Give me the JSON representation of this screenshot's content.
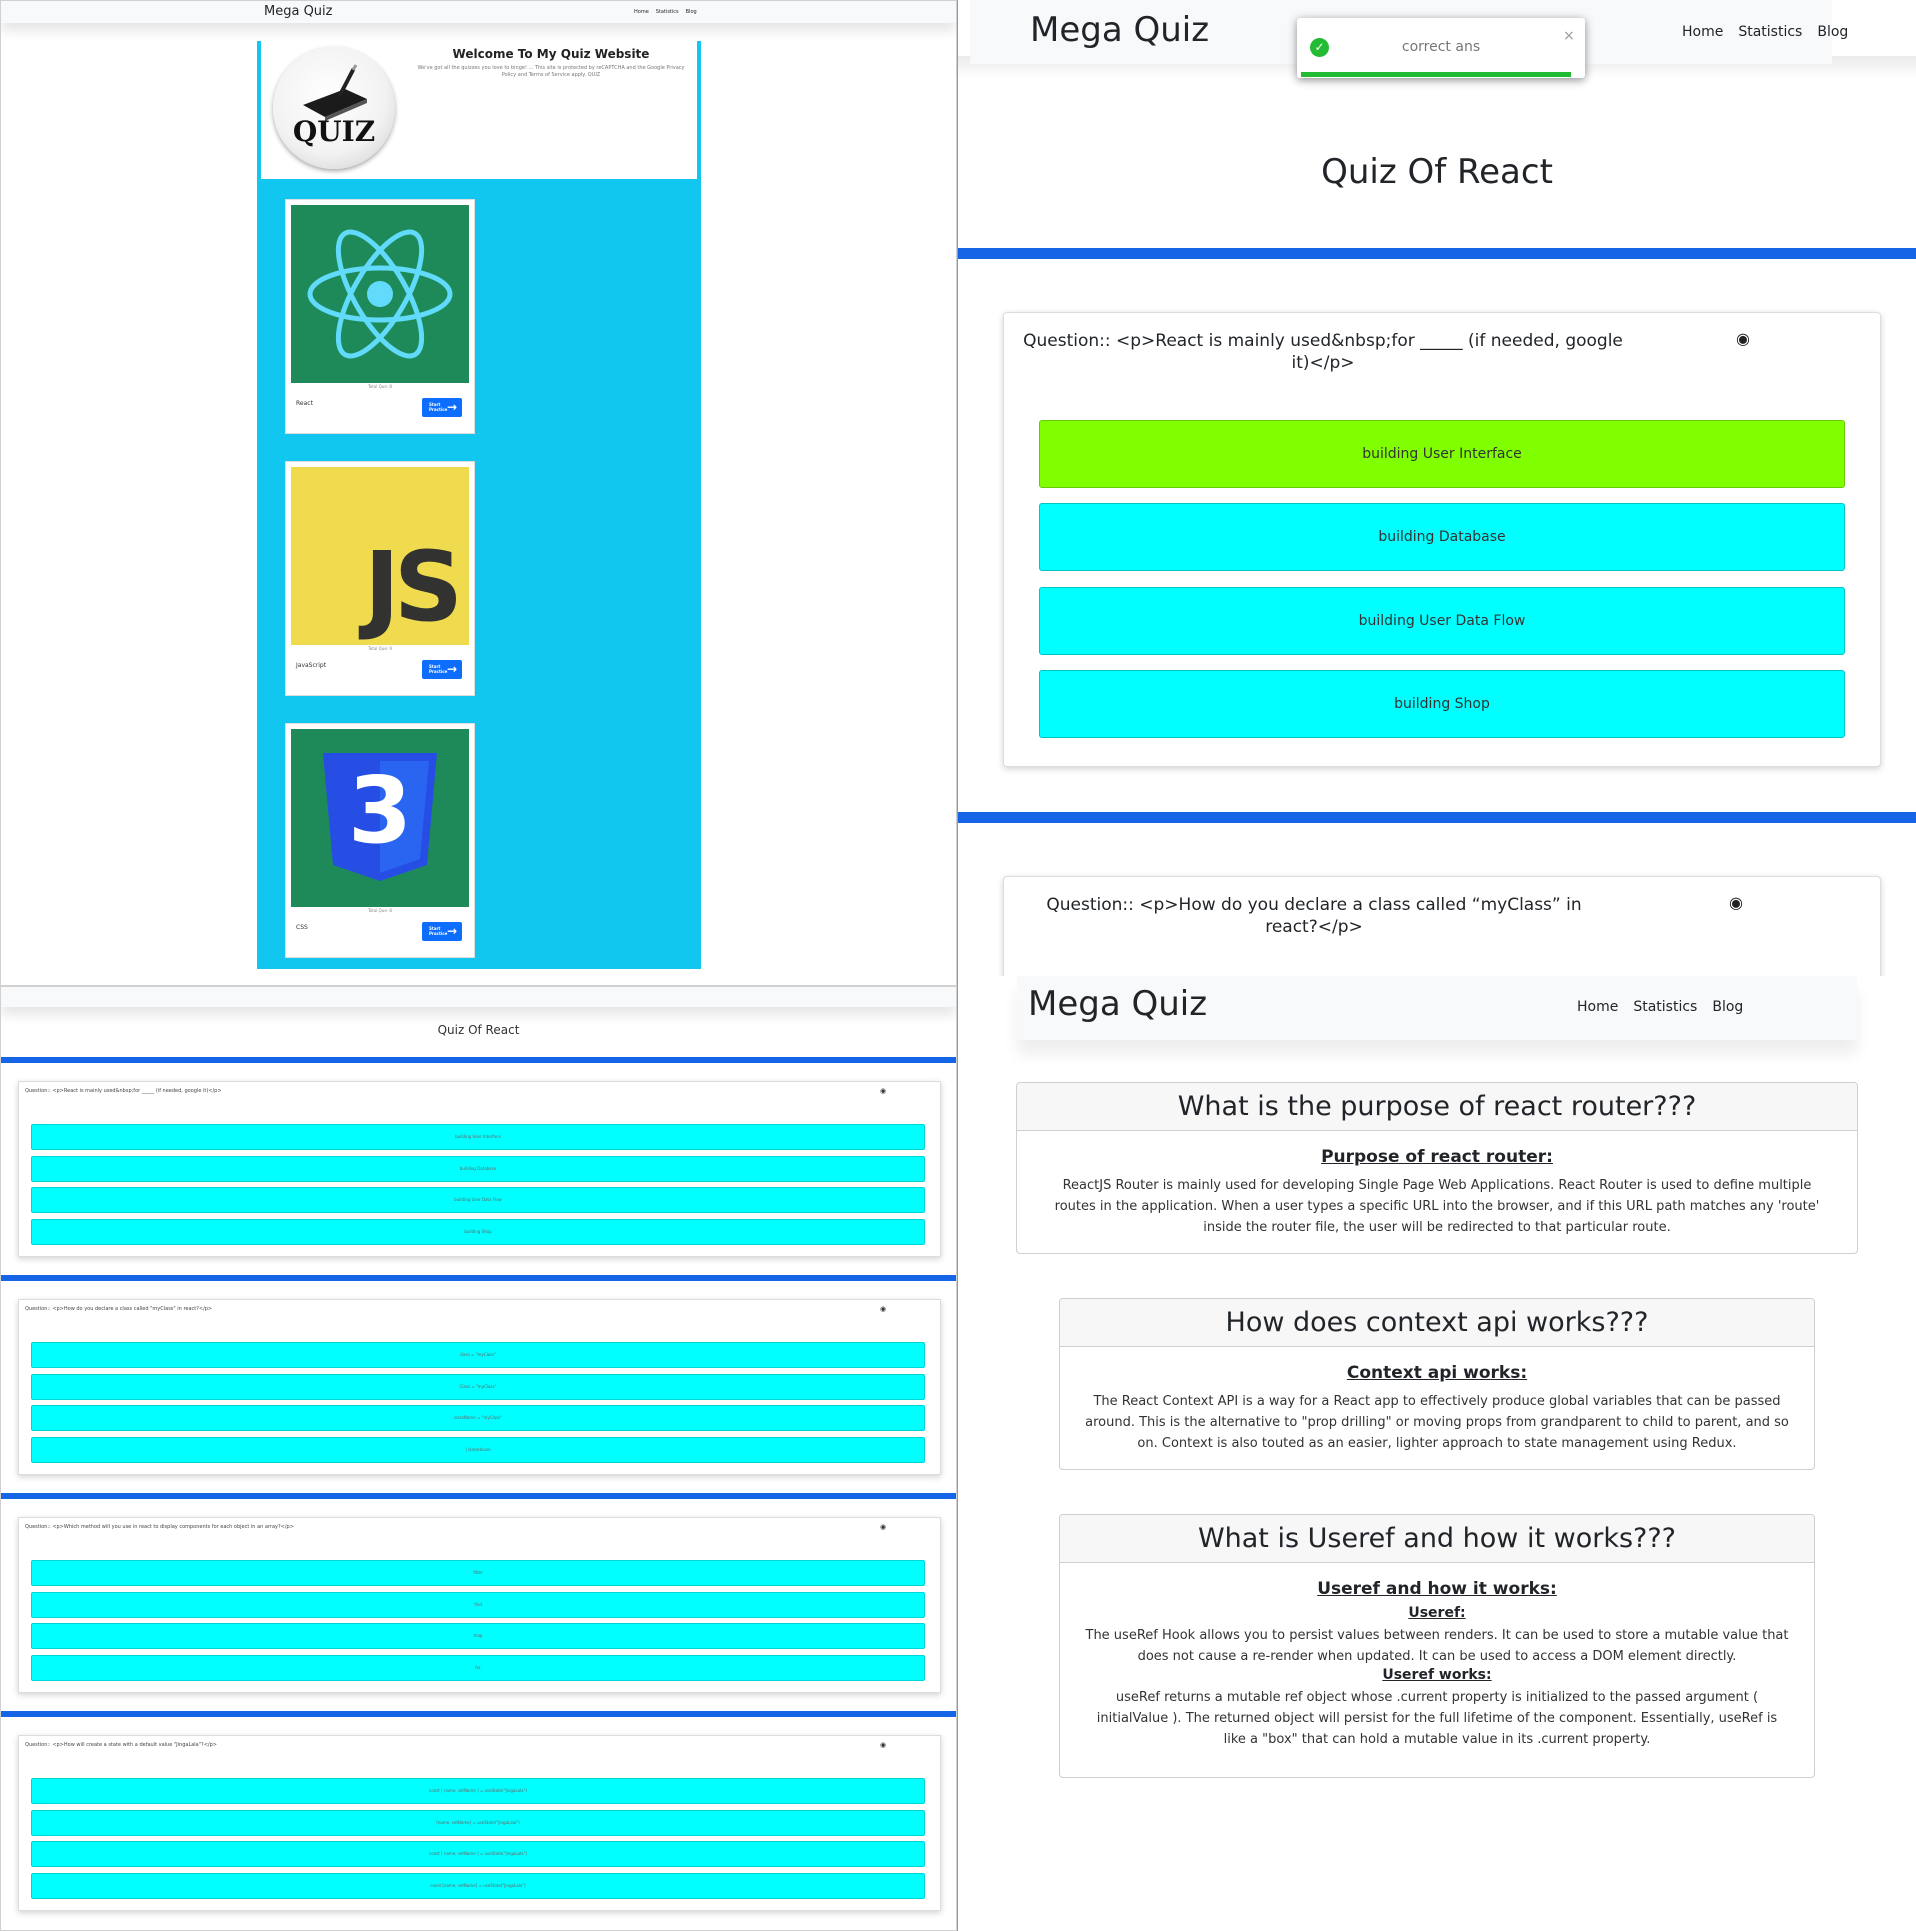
{
  "app": {
    "brand": "Mega Quiz",
    "nav": [
      "Home",
      "Statistics",
      "Blog"
    ]
  },
  "home": {
    "hero_title": "Welcome To My Quiz Website",
    "hero_sub": "We've got all the quizzes you love to binge! ... This site is protected by reCAPTCHA and the Google Privacy Policy and Terms of Service apply. QUIZ",
    "logo_text": "QUIZ",
    "topics": [
      {
        "name": "React",
        "total": "Total Que: 8",
        "btn": "Start Practice"
      },
      {
        "name": "JavaScript",
        "total": "Total Que: 9",
        "btn": "Start Practice"
      },
      {
        "name": "CSS",
        "total": "Total Que: 8",
        "btn": "Start Practice"
      }
    ],
    "js_logo": "JS",
    "css_logo": "3"
  },
  "quiz_list": {
    "title": "Quiz Of React",
    "questions": [
      {
        "q": "Question:: <p>React is mainly used&nbsp;for _____ (if needed, google it)</p>",
        "options": [
          "building User Interface",
          "building Database",
          "building User Data Flow",
          "building Shop"
        ]
      },
      {
        "q": "Question:: <p>How do you declare a class called \"myClass\" in react?</p>",
        "options": [
          "class = \"myClass\"",
          "Class = \"myClass\"",
          "className = \"myClass\"",
          "| classHouse"
        ]
      },
      {
        "q": "Question:: <p>Which method will you use in react to display components for each object in an array?</p>",
        "options": [
          "filter",
          "find",
          "map",
          "for"
        ]
      },
      {
        "q": "Question:: <p>How will create a state with a default value \"JingaLala\"?</p>",
        "options": [
          "const [ name, setName ] = useState(\"JingaLala\")",
          "[name, setName] = useState(\"JingaLala\")",
          "const [ name, setName ] = useState(\"JingaLala\")",
          "const [name, setName] = useState(\"JingaLala\")"
        ]
      }
    ]
  },
  "quiz": {
    "title": "Quiz Of React",
    "toast": {
      "message": "correct ans",
      "close": "×",
      "check": "✓"
    },
    "eye": "◉",
    "q1": {
      "text": "Question:: <p>React is mainly used&nbsp;for _____ (if needed, google it)</p>",
      "options": [
        "building User Interface",
        "building Database",
        "building User Data Flow",
        "building Shop"
      ]
    },
    "q2": {
      "text": "Question:: <p>How do you declare a class called “myClass” in react?</p>"
    }
  },
  "blog": {
    "items": [
      {
        "title": "What is the purpose of react router???",
        "subtitle": "Purpose of react router:",
        "body": "ReactJS Router is mainly used for developing Single Page Web Applications. React Router is used to define multiple routes in the application. When a user types a specific URL into the browser, and if this URL path matches any 'route' inside the router file, the user will be redirected to that particular route."
      },
      {
        "title": "How does context api works???",
        "subtitle": "Context api works:",
        "body": "The React Context API is a way for a React app to effectively produce global variables that can be passed around. This is the alternative to \"prop drilling\" or moving props from grandparent to child to parent, and so on. Context is also touted as an easier, lighter approach to state management using Redux."
      },
      {
        "title": "What is Useref and how it works???",
        "subtitle": "Useref and how it works:",
        "useref_label": "Useref:",
        "useref_body": "The useRef Hook allows you to persist values between renders. It can be used to store a mutable value that does not cause a re-render when updated. It can be used to access a DOM element directly.",
        "works_label": "Useref works:",
        "works_body": "useRef returns a mutable ref object whose .current property is initialized to the passed argument ( initialValue ). The returned object will persist for the full lifetime of the component. Essentially, useRef is like a \"box\" that can hold a mutable value in its .current property."
      }
    ]
  },
  "colors": {
    "accent_blue": "#1565e6",
    "cyan": "#00ffff",
    "correct": "#80ff00",
    "hero_bg": "#12c7ef",
    "react_green": "#1e8a5a",
    "js_yellow": "#f0db4f",
    "css_blue": "#264de4"
  }
}
